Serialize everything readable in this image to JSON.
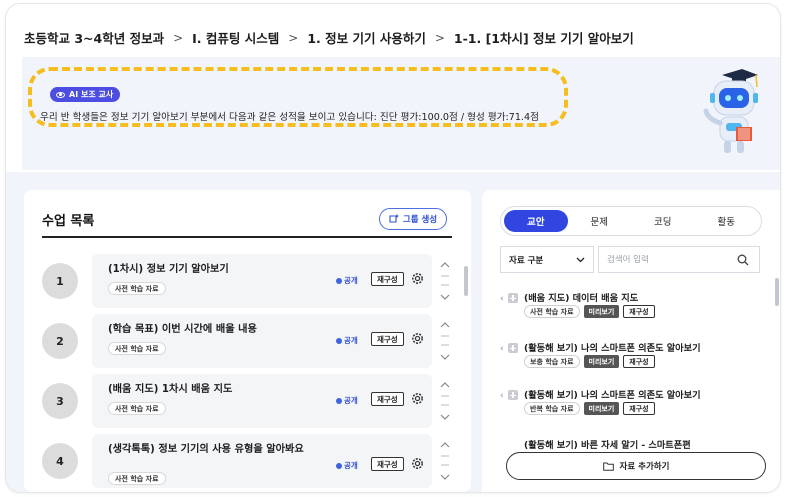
{
  "breadcrumb": [
    "초등학교 3~4학년 정보과",
    "I. 컴퓨팅 시스템",
    "1. 정보 기기 사용하기",
    "1-1. [1차시] 정보 기기 알아보기"
  ],
  "breadcrumb_separator": ">",
  "ai_assistant": {
    "badge": "AI 보조 교사",
    "message": "우리 반 학생들은 정보 기기 알아보기 부분에서 다음과 같은 성적을 보이고 있습니다: 진단 평가:100.0점 / 형성 평가:71.4점"
  },
  "lesson_list": {
    "title": "수업 목록",
    "group_button": "그룹 생성",
    "lessons": [
      {
        "num": "1",
        "title": "(1차시) 정보 기기 알아보기",
        "tag": "사전 학습 자료",
        "visibility": "공개",
        "reform": "재구성"
      },
      {
        "num": "2",
        "title": "(학습 목표) 이번 시간에 배울 내용",
        "tag": "사전 학습 자료",
        "visibility": "공개",
        "reform": "재구성"
      },
      {
        "num": "3",
        "title": "(배움 지도) 1차시 배움 지도",
        "tag": "사전 학습 자료",
        "visibility": "공개",
        "reform": "재구성"
      },
      {
        "num": "4",
        "title": "(생각톡톡) 정보 기기의 사용 유형을 알아봐요",
        "tag": "사전 학습 자료",
        "visibility": "공개",
        "reform": "재구성"
      }
    ]
  },
  "materials": {
    "tabs": [
      "교안",
      "문제",
      "코딩",
      "활동"
    ],
    "active_tab": 0,
    "type_select": "자료 구분",
    "search_placeholder": "검색어 입력",
    "items": [
      {
        "title": "(배움 지도) 데이터 배움 지도",
        "tag": "사전 학습 자료",
        "preview": "미리보기",
        "reform": "재구성"
      },
      {
        "title": "(활동해 보기) 나의 스마트폰 의존도 알아보기",
        "tag": "보충 학습 자료",
        "preview": "미리보기",
        "reform": "재구성"
      },
      {
        "title": "(활동해 보기) 나의 스마트폰 의존도 알아보기",
        "tag": "반복 학습 자료",
        "preview": "미리보기",
        "reform": "재구성"
      },
      {
        "title": "(활동해 보기) 바른 자세 알기 - 스마트폰편"
      }
    ],
    "add_button": "자료 추가하기"
  },
  "colors": {
    "accent": "#3146e0",
    "highlight_dash": "#f5bd1f",
    "panel_bg": "#f1f4fa"
  }
}
